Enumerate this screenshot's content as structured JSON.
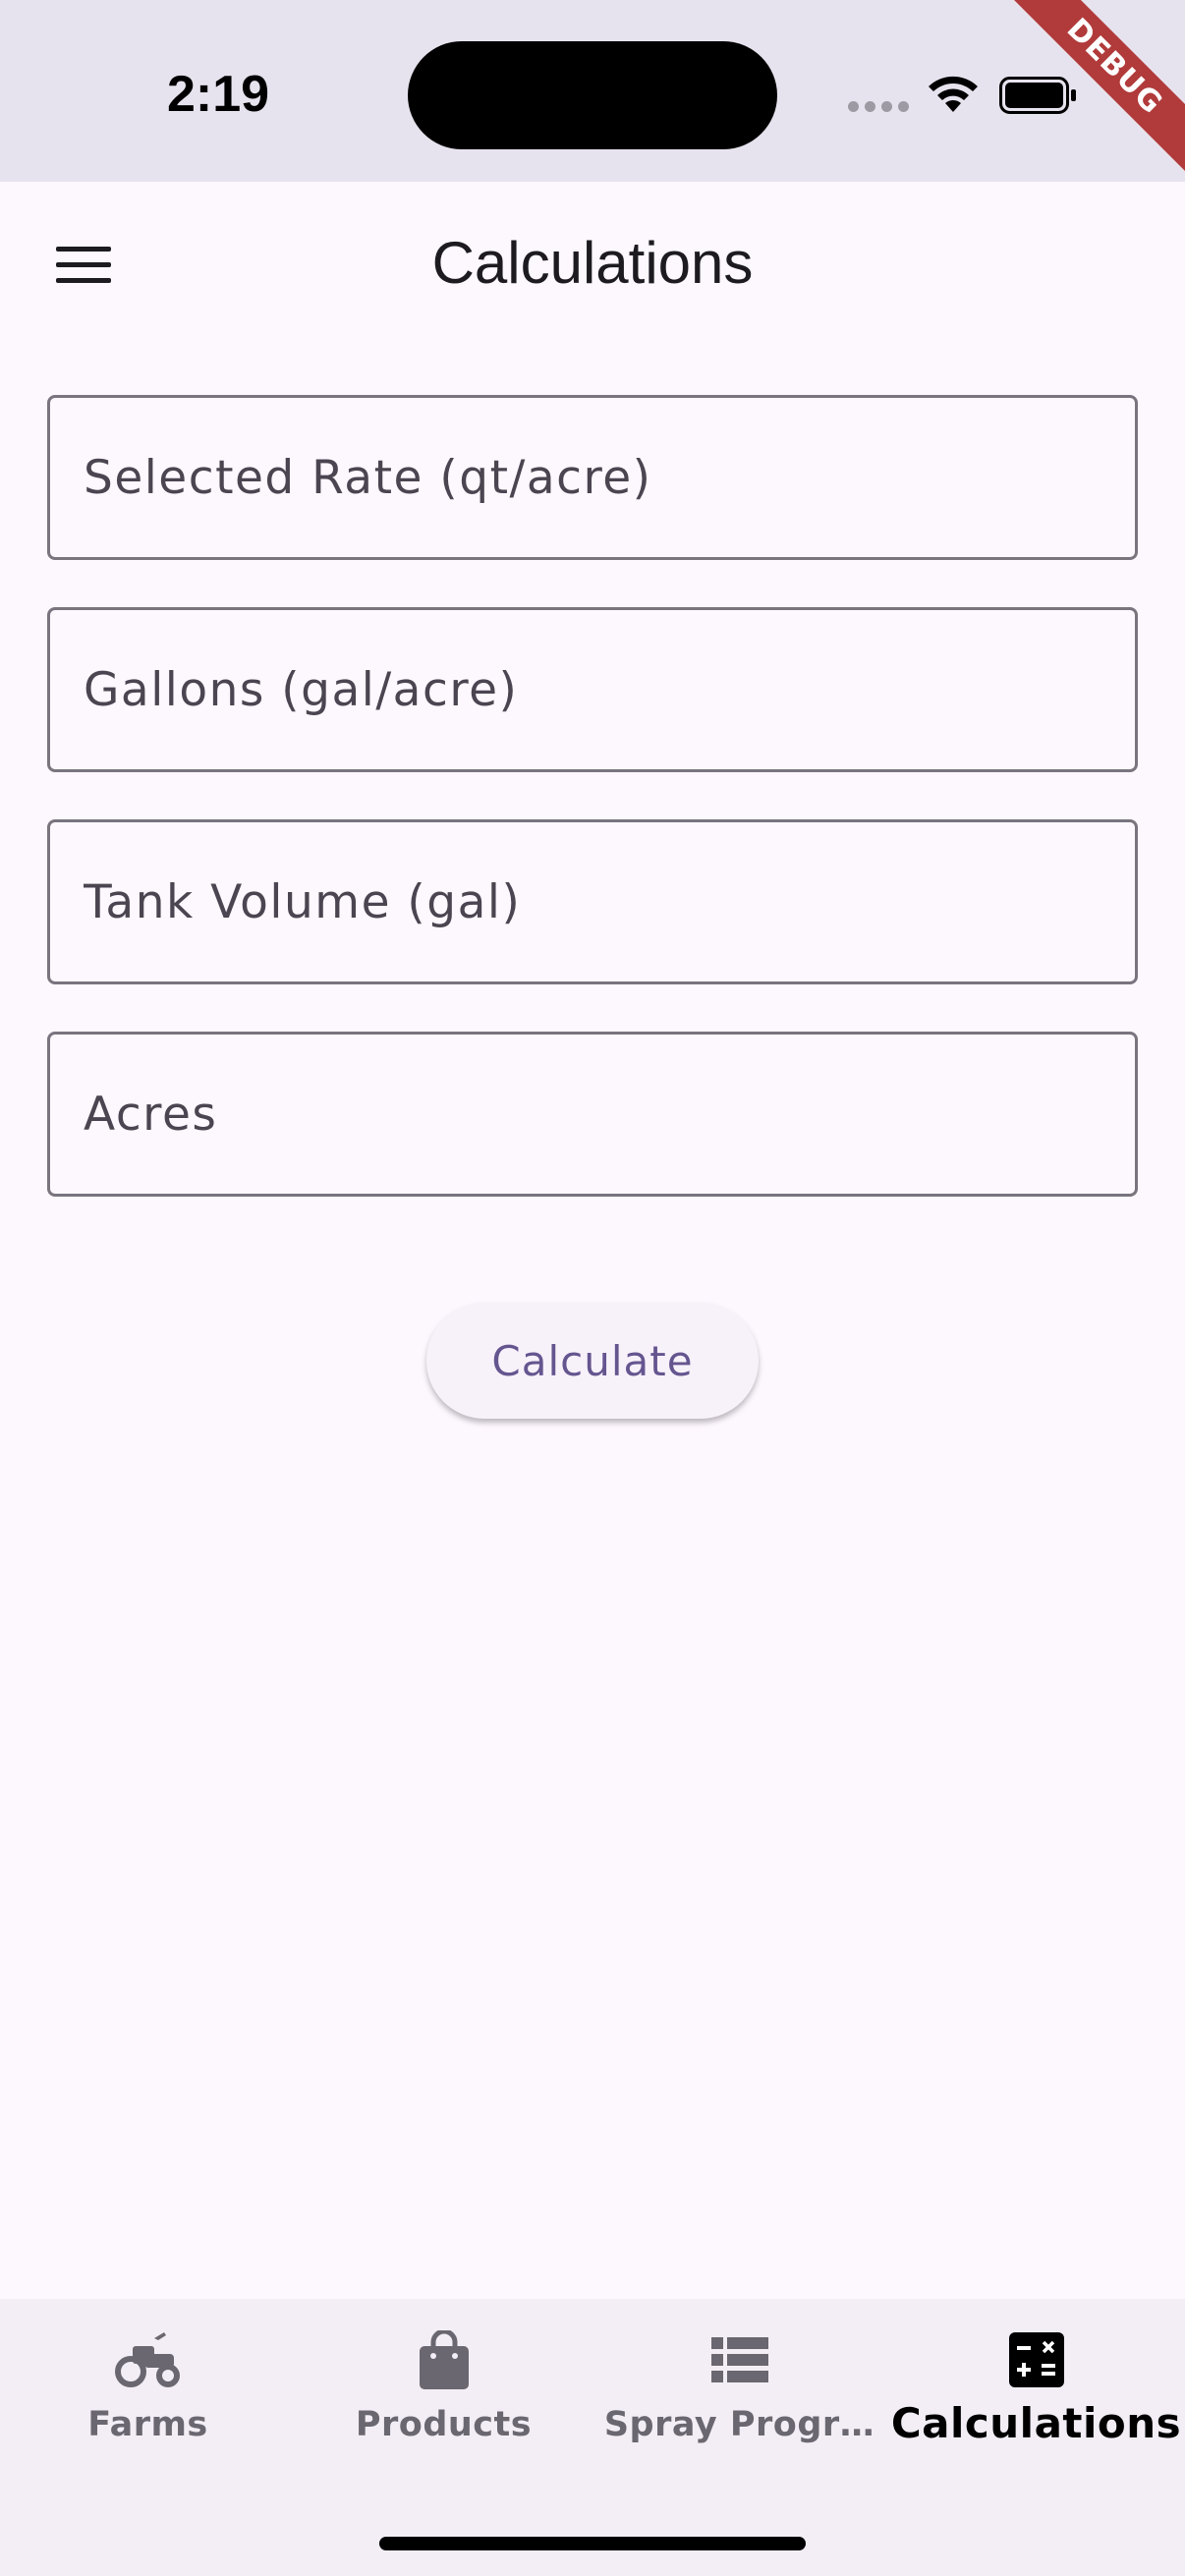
{
  "status_bar": {
    "time": "2:19",
    "debug_label": "DEBUG"
  },
  "app_bar": {
    "title": "Calculations",
    "menu_icon": "hamburger-menu-icon"
  },
  "form": {
    "fields": [
      {
        "placeholder": "Selected Rate (qt/acre)",
        "value": ""
      },
      {
        "placeholder": "Gallons (gal/acre)",
        "value": ""
      },
      {
        "placeholder": "Tank Volume (gal)",
        "value": ""
      },
      {
        "placeholder": "Acres",
        "value": ""
      }
    ],
    "calculate_label": "Calculate"
  },
  "bottom_nav": {
    "items": [
      {
        "label": "Farms",
        "icon": "tractor-icon"
      },
      {
        "label": "Products",
        "icon": "shopping-bag-icon"
      },
      {
        "label": "Spray Progr…",
        "icon": "list-icon"
      },
      {
        "label": "Calculations",
        "icon": "calculate-icon",
        "active": true
      }
    ]
  },
  "colors": {
    "background": "#fdf7fe",
    "status_bar": "#e7e3ee",
    "accent": "#65558f",
    "debug_ribbon": "#b13a3a"
  }
}
